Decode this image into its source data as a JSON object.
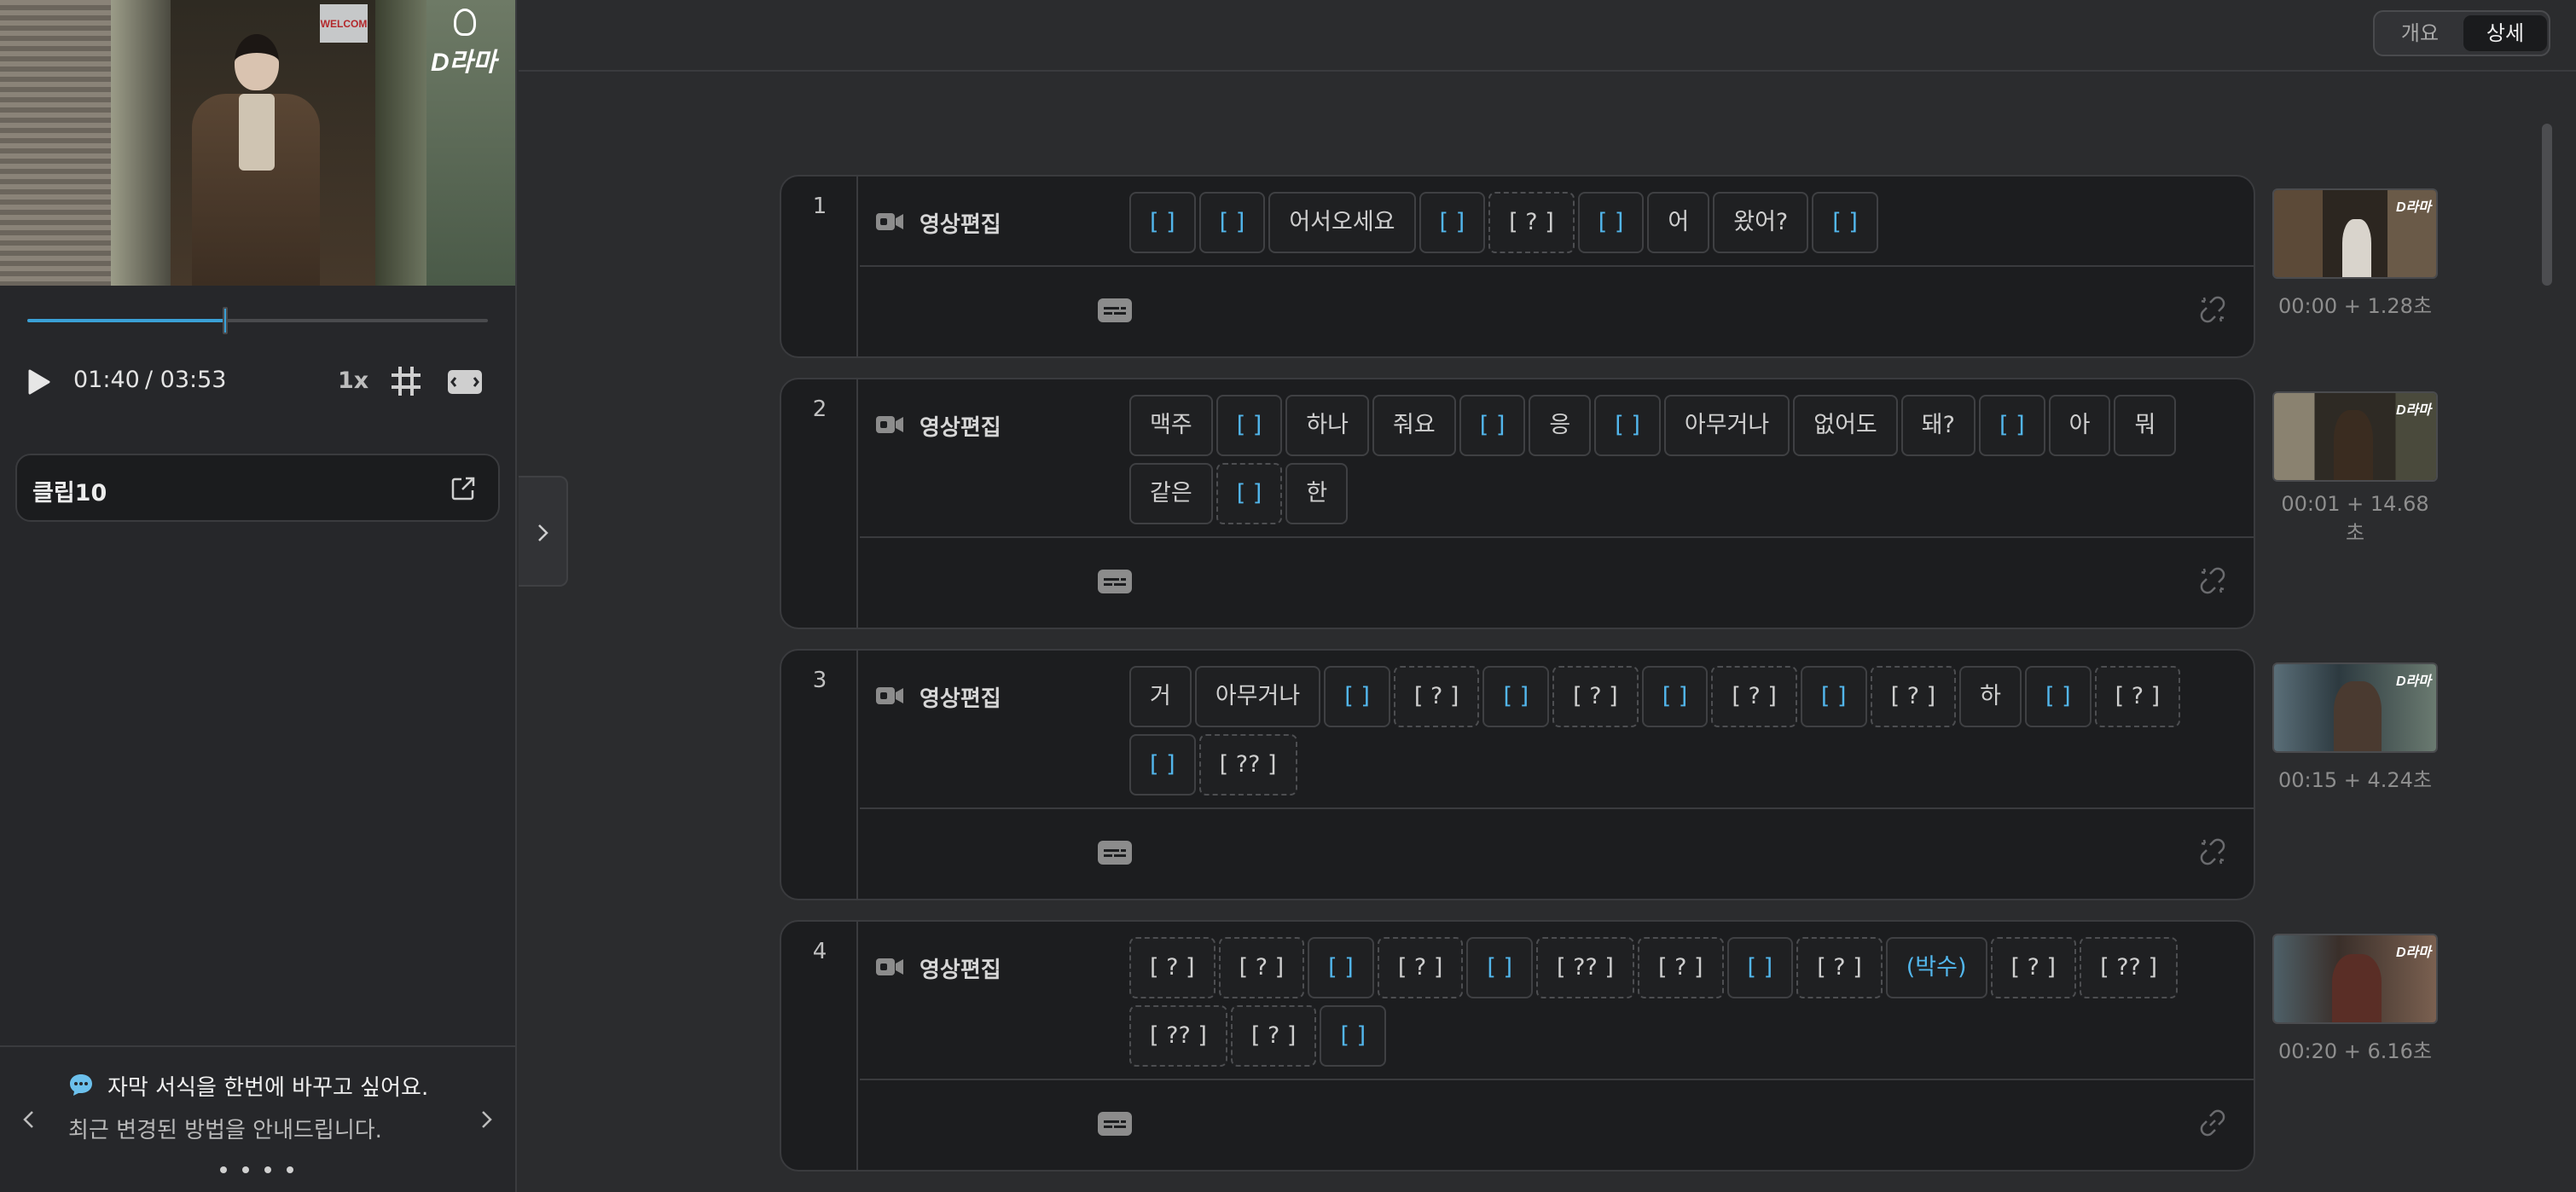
{
  "player": {
    "current_time": "01:40",
    "total_time": "/ 03:53",
    "progress": 0.429,
    "speed": "1x",
    "video_sign": "WELCOM",
    "video_logo": "D라마",
    "icons": [
      "play-icon",
      "grid-icon",
      "aspect-ratio-icon"
    ]
  },
  "clip": {
    "title": "클립10",
    "icon": "open-external-icon"
  },
  "tip": {
    "title": "자막 서식을 한번에 바꾸고 싶어요.",
    "subtitle": "최근 변경된 방법을 안내드립니다.",
    "dot_count": 4,
    "icon": "chat-bubble-icon"
  },
  "view_toggle": {
    "summary": "개요",
    "detail": "상세",
    "active": "detail"
  },
  "colors": {
    "accent": "#3aa0d6",
    "blue_word": "#52b6ec",
    "background": "#2b2c2e",
    "card": "#1c1d1f"
  },
  "scenes": [
    {
      "num": "1",
      "label": "영상편집",
      "timestamp": "00:00 + 1.28초",
      "words": [
        {
          "t": "[ ]",
          "blue": true
        },
        {
          "t": "[ ]",
          "blue": true
        },
        {
          "t": "어서오세요"
        },
        {
          "t": "[ ]",
          "blue": true
        },
        {
          "t": "[ ? ]",
          "dashed": true
        },
        {
          "t": "[ ]",
          "blue": true
        },
        {
          "t": "어"
        },
        {
          "t": "왔어?"
        },
        {
          "t": "[ ]",
          "blue": true
        }
      ],
      "linked": false
    },
    {
      "num": "2",
      "label": "영상편집",
      "timestamp": "00:01 + 14.68초",
      "words": [
        {
          "t": "맥주"
        },
        {
          "t": "[ ]",
          "blue": true
        },
        {
          "t": "하나"
        },
        {
          "t": "줘요"
        },
        {
          "t": "[ ]",
          "blue": true
        },
        {
          "t": "응"
        },
        {
          "t": "[ ]",
          "blue": true
        },
        {
          "t": "아무거나"
        },
        {
          "t": "없어도"
        },
        {
          "t": "돼?"
        },
        {
          "t": "[ ]",
          "blue": true
        },
        {
          "t": "아"
        },
        {
          "t": "뭐"
        },
        {
          "t": "같은"
        },
        {
          "t": "[ ]",
          "blue": true,
          "dashed": true
        },
        {
          "t": "한"
        }
      ],
      "linked": false
    },
    {
      "num": "3",
      "label": "영상편집",
      "timestamp": "00:15 + 4.24초",
      "words": [
        {
          "t": "거"
        },
        {
          "t": "아무거나"
        },
        {
          "t": "[ ]",
          "blue": true
        },
        {
          "t": "[ ? ]",
          "dashed": true
        },
        {
          "t": "[ ]",
          "blue": true
        },
        {
          "t": "[ ? ]",
          "dashed": true
        },
        {
          "t": "[ ]",
          "blue": true
        },
        {
          "t": "[ ? ]",
          "dashed": true
        },
        {
          "t": "[ ]",
          "blue": true
        },
        {
          "t": "[ ? ]",
          "dashed": true
        },
        {
          "t": "하"
        },
        {
          "t": "[ ]",
          "blue": true
        },
        {
          "t": "[ ? ]",
          "dashed": true
        },
        {
          "t": "[ ]",
          "blue": true
        },
        {
          "t": "[ ?? ]",
          "dashed": true
        }
      ],
      "linked": false
    },
    {
      "num": "4",
      "label": "영상편집",
      "timestamp": "00:20 + 6.16초",
      "words": [
        {
          "t": "[ ? ]",
          "dashed": true
        },
        {
          "t": "[ ? ]",
          "dashed": true
        },
        {
          "t": "[ ]",
          "blue": true
        },
        {
          "t": "[ ? ]",
          "dashed": true
        },
        {
          "t": "[ ]",
          "blue": true
        },
        {
          "t": "[ ?? ]",
          "dashed": true
        },
        {
          "t": "[ ? ]",
          "dashed": true
        },
        {
          "t": "[ ]",
          "blue": true
        },
        {
          "t": "[ ? ]",
          "dashed": true
        },
        {
          "t": "(박수)",
          "blue": true
        },
        {
          "t": "[ ? ]",
          "dashed": true
        },
        {
          "t": "[ ?? ]",
          "dashed": true
        },
        {
          "t": "[ ?? ]",
          "dashed": true
        },
        {
          "t": "[ ? ]",
          "dashed": true
        },
        {
          "t": "[ ]",
          "blue": true
        }
      ],
      "linked": true
    }
  ]
}
